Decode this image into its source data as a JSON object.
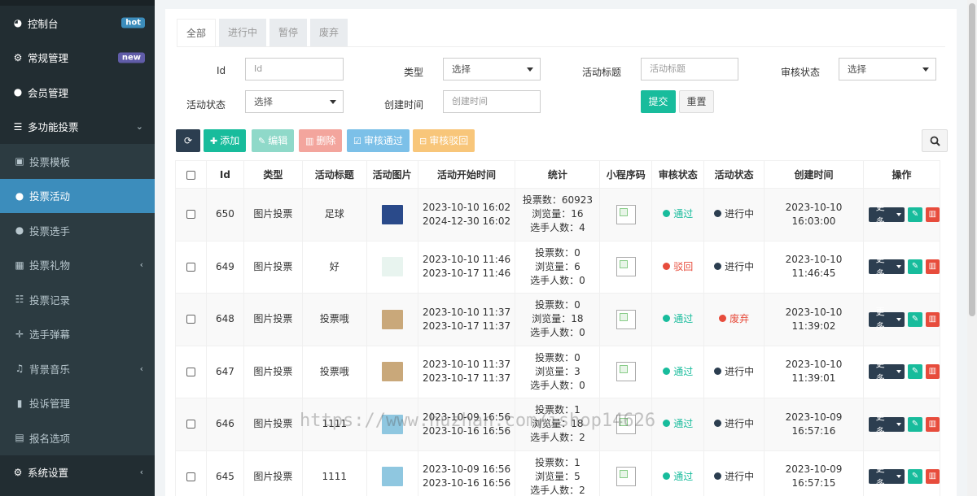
{
  "sidebar": {
    "items": [
      {
        "label": "控制台",
        "icon": "dashboard-icon",
        "glyph": "◕",
        "badge": "hot",
        "badge_color": "#3c8dbc"
      },
      {
        "label": "常规管理",
        "icon": "cogs-icon",
        "glyph": "⚙",
        "badge": "new",
        "badge_color": "#605ca8"
      },
      {
        "label": "会员管理",
        "icon": "user-icon",
        "glyph": "●"
      },
      {
        "label": "多功能投票",
        "icon": "list-icon",
        "glyph": "☰",
        "caret": "⌄"
      }
    ],
    "subitems": [
      {
        "label": "投票模板",
        "icon": "image-icon",
        "glyph": "▣"
      },
      {
        "label": "投票活动",
        "icon": "bomb-icon",
        "glyph": "●",
        "active": true
      },
      {
        "label": "投票选手",
        "icon": "user-plus-icon",
        "glyph": "●"
      },
      {
        "label": "投票礼物",
        "icon": "gift-icon",
        "glyph": "▦",
        "caret": "‹"
      },
      {
        "label": "投票记录",
        "icon": "list-ol-icon",
        "glyph": "☷"
      },
      {
        "label": "选手弹幕",
        "icon": "arrows-icon",
        "glyph": "✛"
      },
      {
        "label": "背景音乐",
        "icon": "music-icon",
        "glyph": "♫",
        "caret": "‹"
      },
      {
        "label": "投诉管理",
        "icon": "bookmark-icon",
        "glyph": "▮"
      },
      {
        "label": "报名选项",
        "icon": "book-icon",
        "glyph": "▤"
      }
    ],
    "bottom": [
      {
        "label": "系统设置",
        "icon": "gear-icon",
        "glyph": "⚙",
        "caret": "‹"
      }
    ]
  },
  "tabs": [
    "全部",
    "进行中",
    "暂停",
    "废弃"
  ],
  "filters": {
    "id_label": "Id",
    "id_placeholder": "Id",
    "type_label": "类型",
    "type_value": "选择",
    "title_label": "活动标题",
    "title_placeholder": "活动标题",
    "audit_label": "审核状态",
    "audit_value": "选择",
    "status_label": "活动状态",
    "status_value": "选择",
    "created_label": "创建时间",
    "created_placeholder": "创建时间",
    "submit": "提交",
    "reset": "重置"
  },
  "toolbar": {
    "refresh_glyph": "⟳",
    "add": "添加",
    "edit": "编辑",
    "delete": "删除",
    "approve": "审核通过",
    "reject": "审核驳回"
  },
  "columns": [
    "Id",
    "类型",
    "活动标题",
    "活动图片",
    "活动开始时间",
    "统计",
    "小程序码",
    "审核状态",
    "活动状态",
    "创建时间",
    "操作"
  ],
  "rows": [
    {
      "id": "650",
      "type": "图片投票",
      "title": "足球",
      "img_color": "#2a4a8a",
      "start": "2023-10-10 16:02",
      "end": "2024-12-30 16:02",
      "stats": [
        "投票数：60923",
        "浏览量：16",
        "选手人数：4"
      ],
      "audit": "通过",
      "audit_color": "#18bc9c",
      "status": "进行中",
      "status_color": "#2c3e50",
      "created": "2023-10-10 16:03:00",
      "more": "更多"
    },
    {
      "id": "649",
      "type": "图片投票",
      "title": "好",
      "img_color": "#e8f4ef",
      "start": "2023-10-10 11:46",
      "end": "2023-10-17 11:46",
      "stats": [
        "投票数：0",
        "浏览量：6",
        "选手人数：0"
      ],
      "audit": "驳回",
      "audit_color": "#e74c3c",
      "status": "进行中",
      "status_color": "#2c3e50",
      "created": "2023-10-10 11:46:45",
      "more": "更多"
    },
    {
      "id": "648",
      "type": "图片投票",
      "title": "投票哦",
      "img_color": "#c9a87a",
      "start": "2023-10-10 11:37",
      "end": "2023-10-17 11:37",
      "stats": [
        "投票数：0",
        "浏览量：18",
        "选手人数：0"
      ],
      "audit": "通过",
      "audit_color": "#18bc9c",
      "status": "废弃",
      "status_color": "#e74c3c",
      "created": "2023-10-10 11:39:02",
      "more": "更多"
    },
    {
      "id": "647",
      "type": "图片投票",
      "title": "投票哦",
      "img_color": "#c9a87a",
      "start": "2023-10-10 11:37",
      "end": "2023-10-17 11:37",
      "stats": [
        "投票数：0",
        "浏览量：3",
        "选手人数：0"
      ],
      "audit": "通过",
      "audit_color": "#18bc9c",
      "status": "进行中",
      "status_color": "#2c3e50",
      "created": "2023-10-10 11:39:01",
      "more": "更多"
    },
    {
      "id": "646",
      "type": "图片投票",
      "title": "1111",
      "img_color": "#8fc7e0",
      "start": "2023-10-09 16:56",
      "end": "2023-10-16 16:56",
      "stats": [
        "投票数：1",
        "浏览量：18",
        "选手人数：2"
      ],
      "audit": "通过",
      "audit_color": "#18bc9c",
      "status": "进行中",
      "status_color": "#2c3e50",
      "created": "2023-10-09 16:57:16",
      "more": "更多"
    },
    {
      "id": "645",
      "type": "图片投票",
      "title": "1111",
      "img_color": "#8fc7e0",
      "start": "2023-10-09 16:56",
      "end": "2023-10-16 16:56",
      "stats": [
        "投票数：1",
        "浏览量：5",
        "选手人数：2"
      ],
      "audit": "通过",
      "audit_color": "#18bc9c",
      "status": "进行中",
      "status_color": "#2c3e50",
      "created": "2023-10-09 16:57:15",
      "more": "更多"
    }
  ],
  "watermark": "https://www.huzhan.com/ishop14626"
}
